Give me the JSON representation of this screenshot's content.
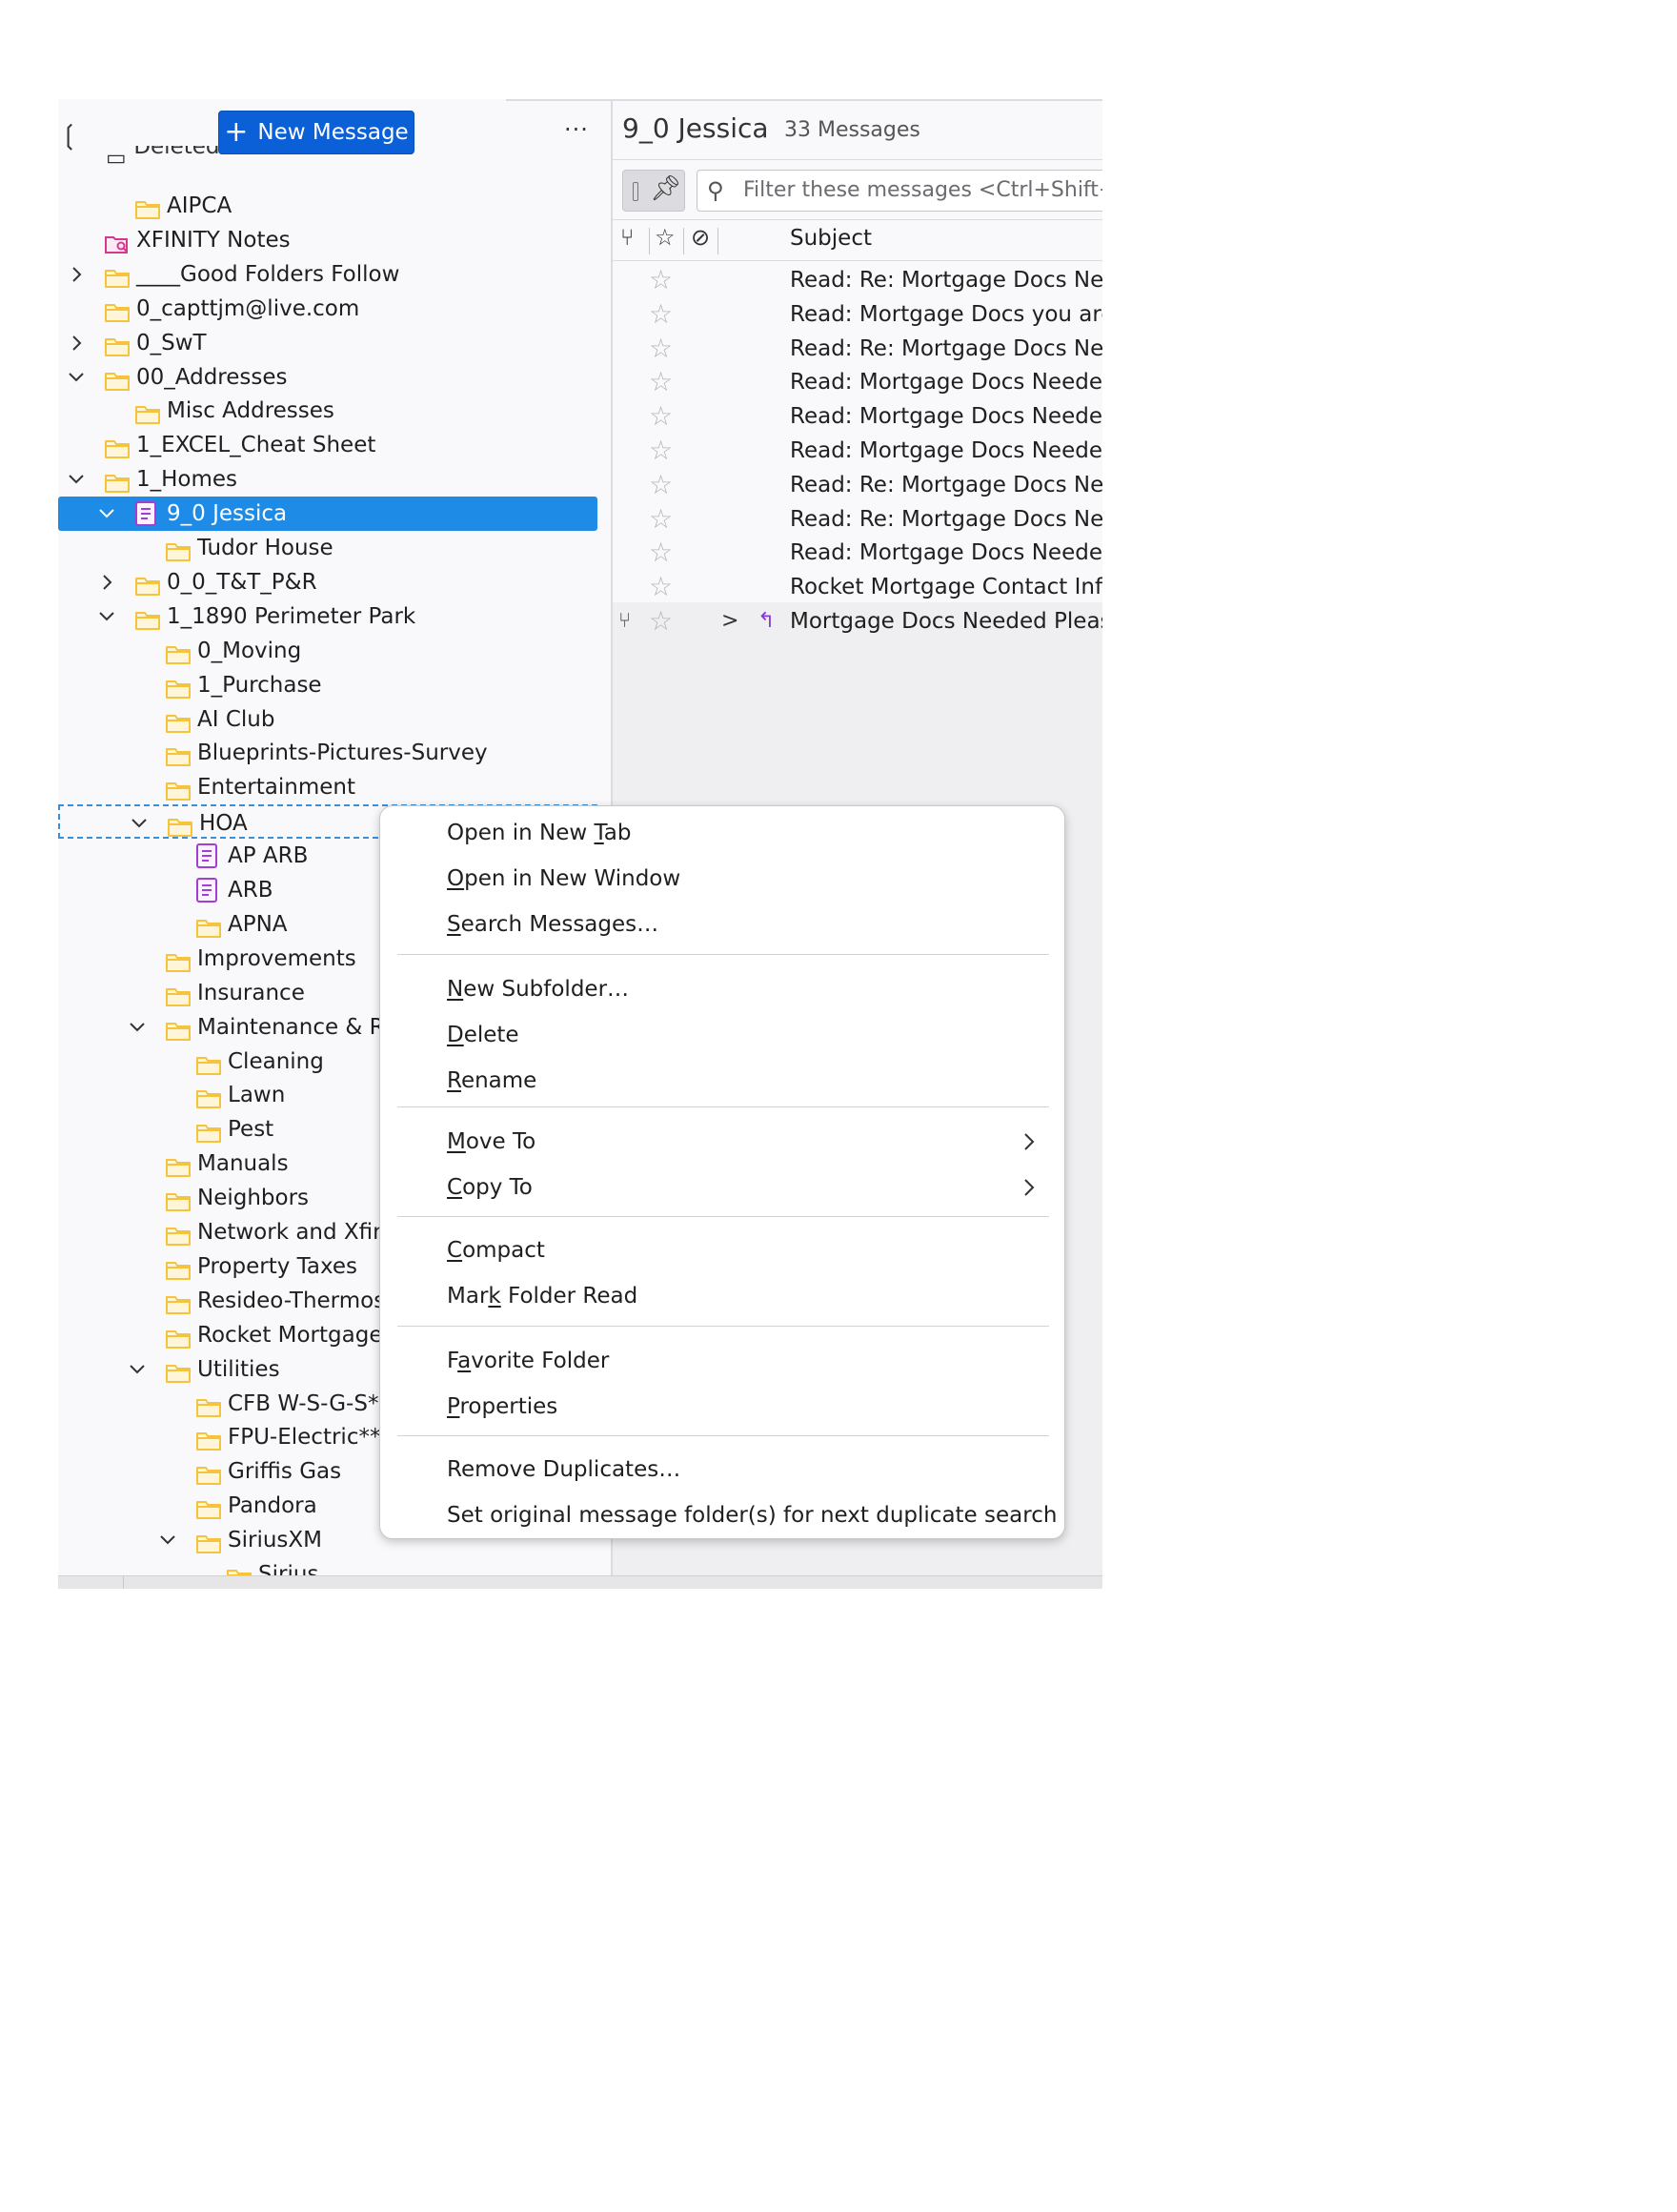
{
  "toolbar": {
    "new_message_label": "New Message",
    "new_message_icon": "plus-icon",
    "more_label": "···",
    "sidebar_toggle_label": "❲"
  },
  "folders": {
    "deleted_partial": "Deleted",
    "rows": [
      {
        "label": "AIPCA",
        "icon": "folder-icon"
      },
      {
        "label": "XFINITY Notes",
        "icon": "saved-search-folder-icon"
      },
      {
        "label": "____Good Folders Follow",
        "icon": "folder-icon",
        "expander": "collapsed"
      },
      {
        "label": "0_capttjm@live.com",
        "icon": "folder-icon"
      },
      {
        "label": "0_SwT",
        "icon": "folder-icon",
        "expander": "collapsed"
      },
      {
        "label": "00_Addresses",
        "icon": "folder-icon",
        "expander": "expanded"
      },
      {
        "label": "Misc Addresses",
        "icon": "folder-icon"
      },
      {
        "label": "1_EXCEL_Cheat Sheet",
        "icon": "folder-icon"
      },
      {
        "label": "1_Homes",
        "icon": "folder-icon",
        "expander": "expanded"
      },
      {
        "label": "9_0 Jessica",
        "icon": "virtual-folder-icon",
        "expander": "expanded",
        "selected": true
      },
      {
        "label": "Tudor House",
        "icon": "folder-icon"
      },
      {
        "label": "0_0_T&T_P&R",
        "icon": "folder-icon",
        "expander": "collapsed"
      },
      {
        "label": "1_1890 Perimeter Park",
        "icon": "folder-icon",
        "expander": "expanded"
      },
      {
        "label": "0_Moving",
        "icon": "folder-icon"
      },
      {
        "label": "1_Purchase",
        "icon": "folder-icon"
      },
      {
        "label": "AI Club",
        "icon": "folder-icon"
      },
      {
        "label": "Blueprints-Pictures-Survey",
        "icon": "folder-icon"
      },
      {
        "label": "Entertainment",
        "icon": "folder-icon"
      },
      {
        "label": "HOA",
        "icon": "folder-icon",
        "expander": "expanded"
      },
      {
        "label": "AP ARB",
        "icon": "virtual-folder-icon"
      },
      {
        "label": "ARB",
        "icon": "virtual-folder-icon"
      },
      {
        "label": "APNA",
        "icon": "folder-icon"
      },
      {
        "label": "Improvements",
        "icon": "folder-icon"
      },
      {
        "label": "Insurance",
        "icon": "folder-icon"
      },
      {
        "label": "Maintenance & R",
        "icon": "folder-icon",
        "expander": "expanded"
      },
      {
        "label": "Cleaning",
        "icon": "folder-icon"
      },
      {
        "label": "Lawn",
        "icon": "folder-icon"
      },
      {
        "label": "Pest",
        "icon": "folder-icon"
      },
      {
        "label": "Manuals",
        "icon": "folder-icon"
      },
      {
        "label": "Neighbors",
        "icon": "folder-icon"
      },
      {
        "label": "Network and Xfin",
        "icon": "folder-icon"
      },
      {
        "label": "Property Taxes",
        "icon": "folder-icon"
      },
      {
        "label": "Resideo-Thermos",
        "icon": "folder-icon"
      },
      {
        "label": "Rocket Mortgage",
        "icon": "folder-icon"
      },
      {
        "label": "Utilities",
        "icon": "folder-icon",
        "expander": "expanded"
      },
      {
        "label": "CFB W-S-G-S*",
        "icon": "folder-icon"
      },
      {
        "label": "FPU-Electric**",
        "icon": "folder-icon"
      },
      {
        "label": "Griffis Gas",
        "icon": "folder-icon"
      },
      {
        "label": "Pandora",
        "icon": "folder-icon"
      },
      {
        "label": "SiriusXM",
        "icon": "folder-icon",
        "expander": "expanded"
      },
      {
        "label": "Sirius",
        "icon": "folder-icon"
      }
    ]
  },
  "message_pane": {
    "folder_title": "9_0 Jessica",
    "message_count": "33 Messages",
    "filter_placeholder": "Filter these messages <Ctrl+Shift+K>",
    "subject_header": "Subject",
    "header_icons": [
      "thread-icon",
      "star-icon",
      "attachment-icon"
    ],
    "messages": [
      {
        "subject": "Read: Re: Mortgage Docs Needed"
      },
      {
        "subject": "Read: Mortgage Docs you are"
      },
      {
        "subject": "Read: Re: Mortgage Docs Needed"
      },
      {
        "subject": "Read: Mortgage Docs Needed."
      },
      {
        "subject": "Read: Mortgage Docs Needed."
      },
      {
        "subject": "Read: Mortgage Docs Needed."
      },
      {
        "subject": "Read: Re: Mortgage Docs Needed"
      },
      {
        "subject": "Read: Re: Mortgage Docs Needed"
      },
      {
        "subject": "Read: Mortgage Docs Needed."
      },
      {
        "subject": "Rocket Mortgage Contact Info"
      },
      {
        "subject": "Mortgage Docs Needed Please",
        "thread": true,
        "replied": true
      }
    ]
  },
  "context_menu": {
    "groups": [
      [
        {
          "label": "Open in New Tab",
          "accesskey_index": 12
        },
        {
          "label": "Open in New Window",
          "accesskey_index": 0
        },
        {
          "label": "Search Messages…",
          "accesskey_index": 0
        }
      ],
      [
        {
          "label": "New Subfolder…",
          "accesskey_index": 0
        },
        {
          "label": "Delete",
          "accesskey_index": 0
        },
        {
          "label": "Rename",
          "accesskey_index": 0
        }
      ],
      [
        {
          "label": "Move To",
          "accesskey_index": 0,
          "submenu": true
        },
        {
          "label": "Copy To",
          "accesskey_index": 0,
          "submenu": true
        }
      ],
      [
        {
          "label": "Compact",
          "accesskey_index": 0
        },
        {
          "label": "Mark Folder Read",
          "accesskey_index": 3
        }
      ],
      [
        {
          "label": "Favorite Folder",
          "accesskey_index": 1
        },
        {
          "label": "Properties",
          "accesskey_index": 0
        }
      ],
      [
        {
          "label": "Remove Duplicates…",
          "accesskey_index": -1
        },
        {
          "label": "Set original message folder(s) for next duplicate search",
          "accesskey_index": -1
        }
      ]
    ]
  },
  "colors": {
    "accent": "#0b60d8",
    "selected_row": "#1e8be6",
    "folder_yellow": "#f5c43c",
    "virtual_folder_purple": "#a23fd0",
    "search_folder_pink": "#d4398d"
  }
}
